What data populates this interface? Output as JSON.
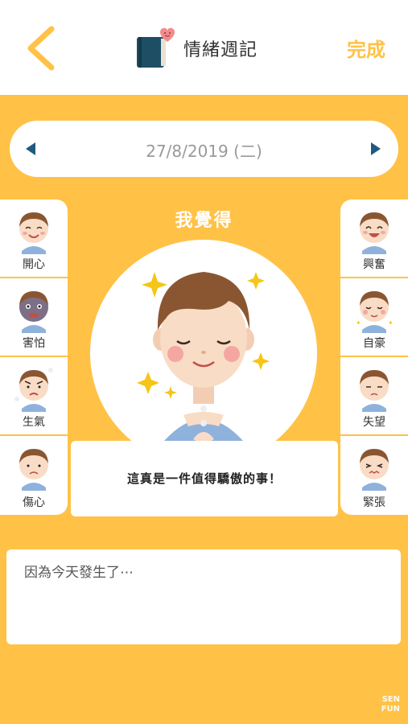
{
  "header": {
    "title": "情緒週記",
    "done_label": "完成",
    "back_icon": "chevron-left-icon",
    "title_icon": "diary-heart-icon",
    "accent_color": "#ffc247"
  },
  "date_bar": {
    "date": "27/8/2019 (二)",
    "prev_icon": "triangle-left-icon",
    "next_icon": "triangle-right-icon"
  },
  "emotions_left": [
    {
      "label": "開心",
      "icon": "happy-face-icon"
    },
    {
      "label": "害怕",
      "icon": "scared-face-icon"
    },
    {
      "label": "生氣",
      "icon": "angry-face-icon"
    },
    {
      "label": "傷心",
      "icon": "sad-face-icon"
    }
  ],
  "emotions_right": [
    {
      "label": "興奮",
      "icon": "excited-face-icon"
    },
    {
      "label": "自豪",
      "icon": "proud-face-icon"
    },
    {
      "label": "失望",
      "icon": "disappointed-face-icon"
    },
    {
      "label": "緊張",
      "icon": "nervous-face-icon"
    }
  ],
  "main": {
    "heading": "我覺得",
    "selected_emotion_icon": "proud-boy-illustration",
    "message": "這真是一件值得驕傲的事！"
  },
  "because": {
    "placeholder": "因為今天發生了⋯"
  },
  "watermark": {
    "line1": "SEN",
    "line2": "FUN"
  }
}
